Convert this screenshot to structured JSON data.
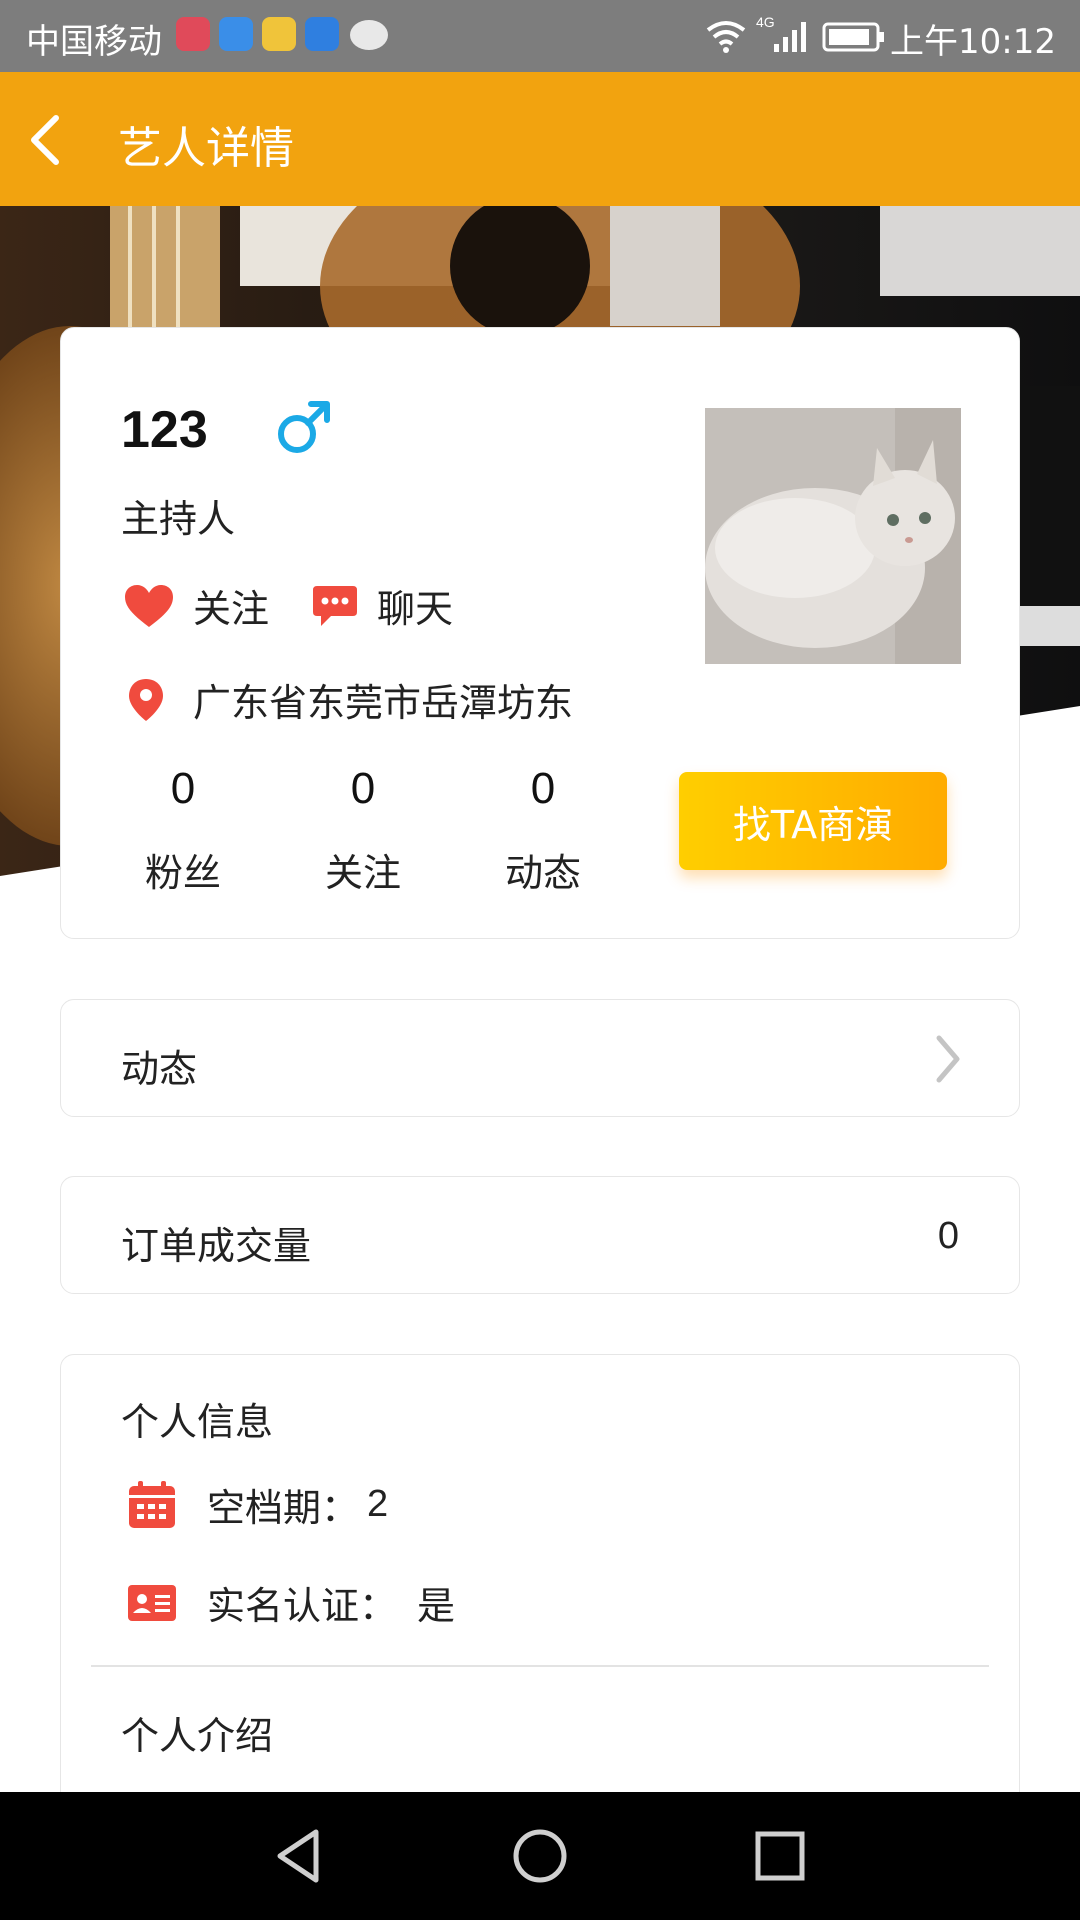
{
  "status_bar": {
    "carrier": "中国移动",
    "time": "上午10:12",
    "network": "4G"
  },
  "app_bar": {
    "title": "艺人详情"
  },
  "profile": {
    "name": "123",
    "gender": "male",
    "role": "主持人",
    "follow_label": "关注",
    "chat_label": "聊天",
    "location": "广东省东莞市岳潭坊东",
    "stats": [
      {
        "value": "0",
        "label": "粉丝"
      },
      {
        "value": "0",
        "label": "关注"
      },
      {
        "value": "0",
        "label": "动态"
      }
    ],
    "cta_label": "找TA商演"
  },
  "dynamics_row": {
    "label": "动态"
  },
  "orders_row": {
    "label": "订单成交量",
    "value": "0"
  },
  "info": {
    "title": "个人信息",
    "schedule_label": "空档期：",
    "schedule_value": "2",
    "verified_label": "实名认证：",
    "verified_value": "是",
    "intro_title": "个人介绍"
  },
  "colors": {
    "accent": "#f2a30f",
    "cta_start": "#ffce00",
    "cta_end": "#ffab00",
    "icon_red": "#f04b3e",
    "gender_blue": "#1ba9e6"
  },
  "icons": [
    "back-arrow-icon",
    "male-icon",
    "heart-icon",
    "chat-bubble-icon",
    "location-pin-icon",
    "chevron-right-icon",
    "calendar-icon",
    "id-card-icon"
  ]
}
